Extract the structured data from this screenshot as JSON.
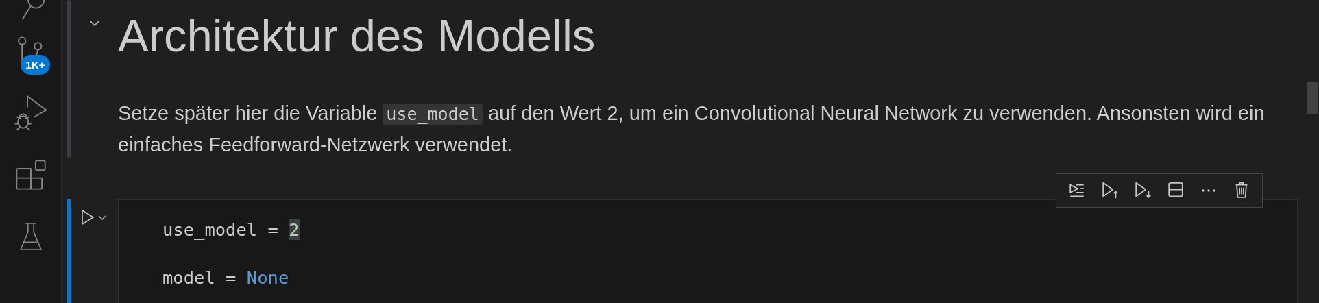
{
  "activity_bar": {
    "items": [
      {
        "kind": "search",
        "selected": false
      },
      {
        "kind": "source-control",
        "selected": false,
        "badge": "1K+"
      },
      {
        "kind": "run-debug",
        "selected": false
      },
      {
        "kind": "extensions",
        "selected": false
      },
      {
        "kind": "testing",
        "selected": false
      }
    ]
  },
  "markdown_cell": {
    "expanded": true,
    "heading": "Architektur des Modells",
    "paragraph": [
      {
        "kind": "text",
        "text": "Setze später hier die Variable "
      },
      {
        "kind": "code",
        "text": "use_model"
      },
      {
        "kind": "text",
        "text": " auf den Wert 2, um ein Convolutional Neural Network zu verwenden. Ansonsten wird ein einfaches Feedforward-Netzwerk verwendet."
      }
    ]
  },
  "cell_toolbar": [
    {
      "kind": "execute-above"
    },
    {
      "kind": "execute-below-run"
    },
    {
      "kind": "execute-below"
    },
    {
      "kind": "split"
    },
    {
      "kind": "more"
    },
    {
      "kind": "delete"
    }
  ],
  "code_cell": {
    "selected": true,
    "lines": [
      [
        {
          "kind": "plain",
          "text": "use_model = "
        },
        {
          "kind": "number",
          "text": "2",
          "highlighted": true
        }
      ],
      [
        {
          "kind": "plain",
          "text": "model = "
        },
        {
          "kind": "keyword",
          "text": "None"
        }
      ]
    ]
  }
}
